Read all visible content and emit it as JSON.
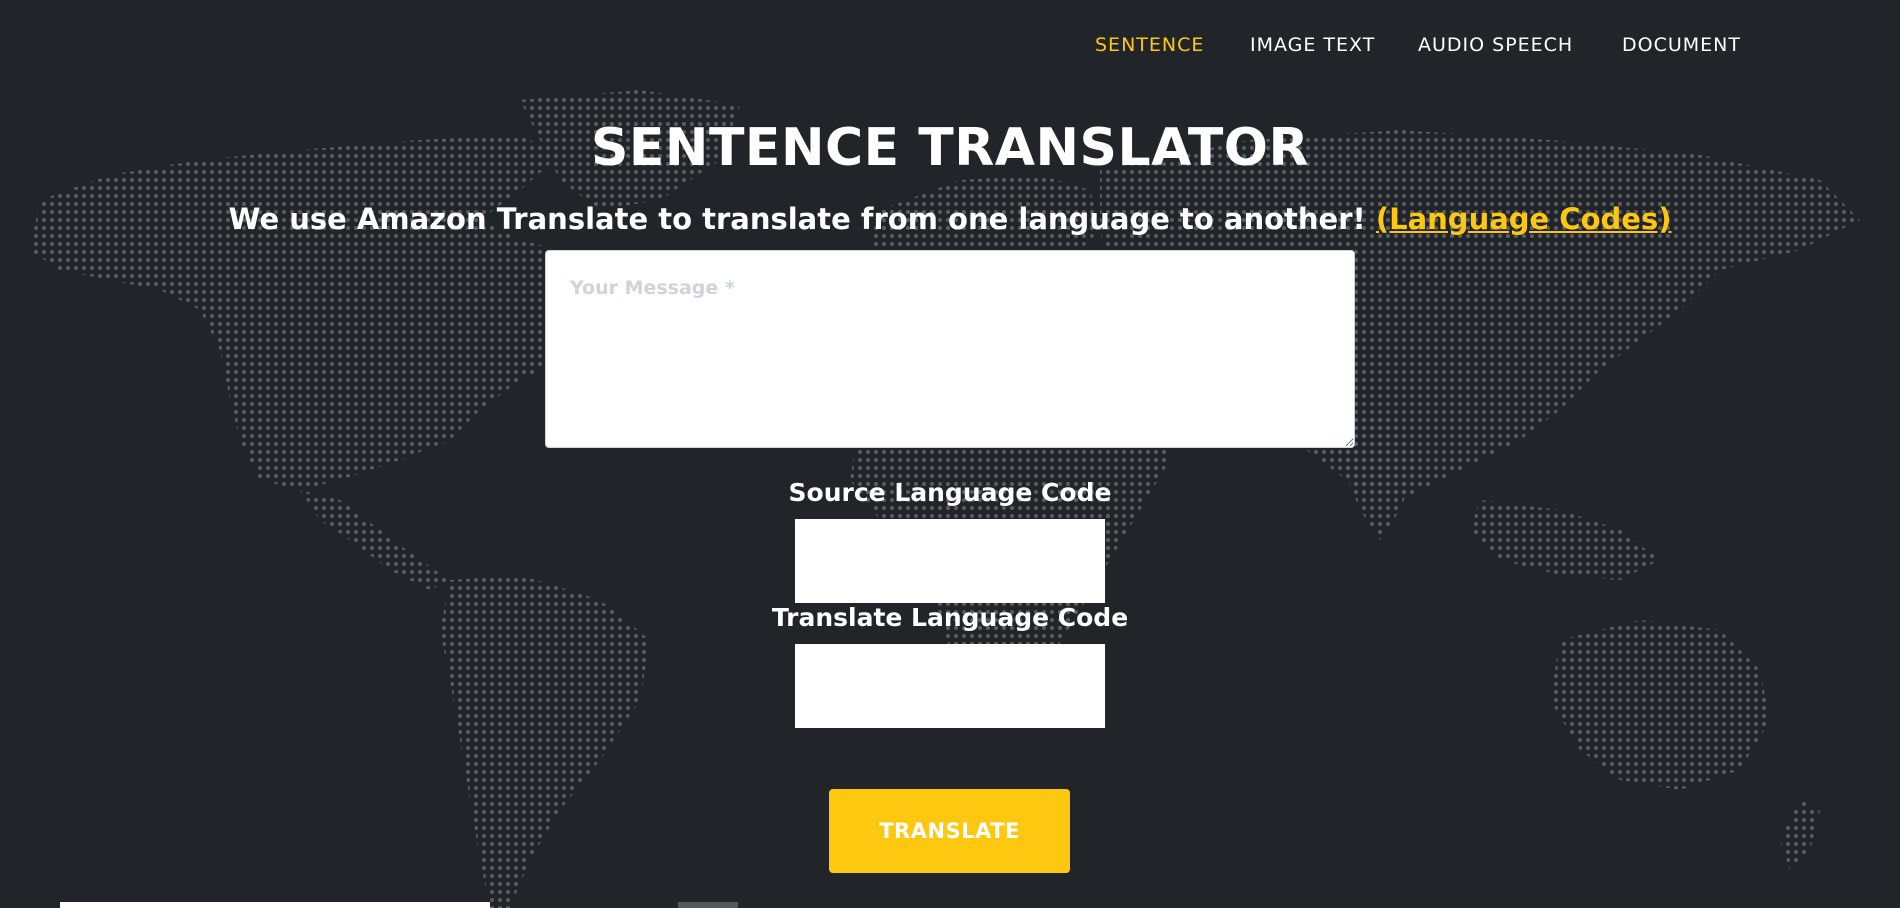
{
  "nav": {
    "items": [
      {
        "label": "SENTENCE",
        "active": true
      },
      {
        "label": "IMAGE TEXT",
        "active": false
      },
      {
        "label": "AUDIO SPEECH",
        "active": false
      },
      {
        "label": "DOCUMENT",
        "active": false
      }
    ]
  },
  "hero": {
    "title": "SENTENCE TRANSLATOR",
    "subtitle": "We use Amazon Translate to translate from one language to another!",
    "link_label": "(Language Codes)"
  },
  "form": {
    "message_placeholder": "Your Message *",
    "source_label": "Source Language Code",
    "target_label": "Translate Language Code",
    "submit_label": "TRANSLATE"
  },
  "colors": {
    "background": "#212529",
    "accent": "#fec810",
    "text": "#ffffff",
    "map_dot": "#8a8d91"
  },
  "icons": {
    "background_map": "world-map-dots"
  }
}
